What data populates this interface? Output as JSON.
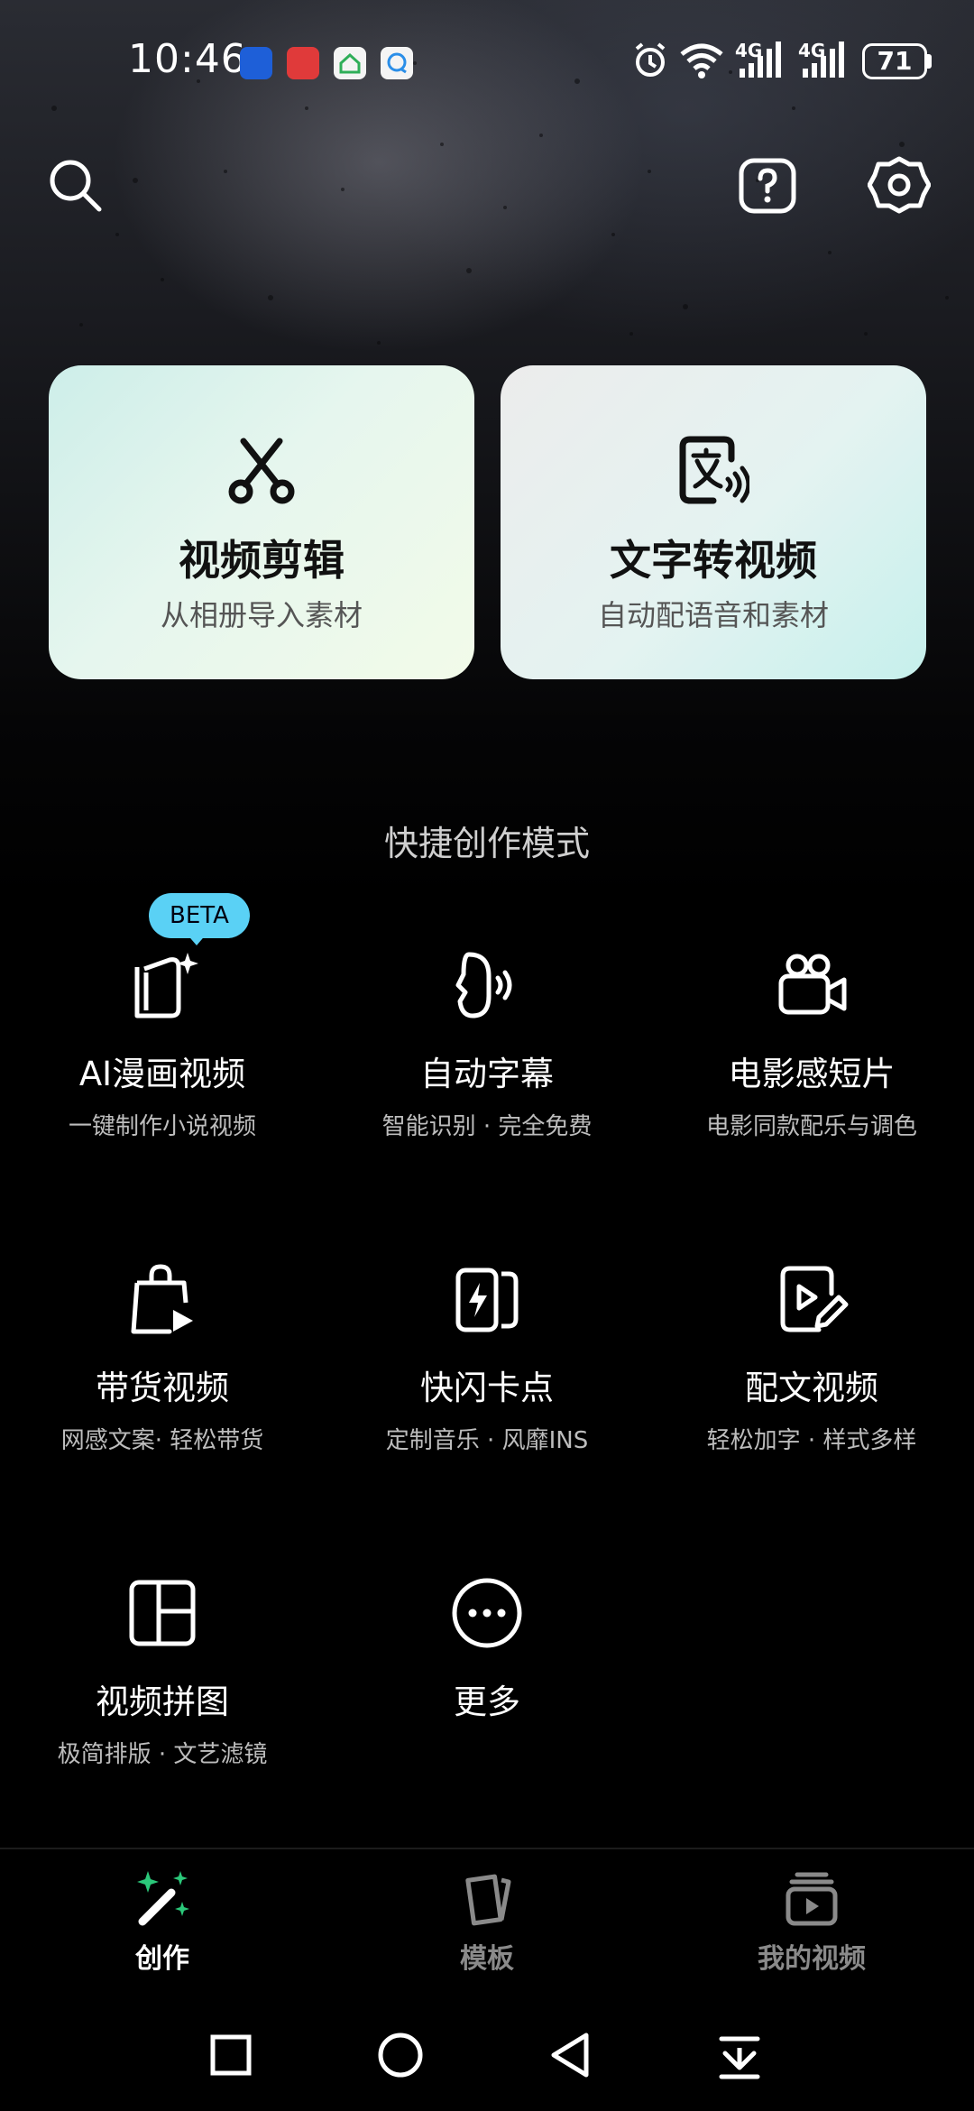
{
  "status_bar": {
    "time": "10:46",
    "battery": "71",
    "network_1": "4G",
    "network_2": "4G",
    "app_icons": [
      "blue-app-icon",
      "red-app-icon",
      "green-house-app-icon",
      "chat-bubble-app-icon"
    ]
  },
  "header": {
    "search_icon": "search-icon",
    "help_icon": "help-icon",
    "settings_icon": "gear-icon"
  },
  "cards": [
    {
      "title": "视频剪辑",
      "subtitle": "从相册导入素材",
      "icon": "scissors-icon"
    },
    {
      "title": "文字转视频",
      "subtitle": "自动配语音和素材",
      "icon": "text-to-speech-icon"
    }
  ],
  "section_title": "快捷创作模式",
  "beta_label": "BETA",
  "modes": [
    {
      "title": "AI漫画视频",
      "subtitle": "一键制作小说视频",
      "icon": "book-sparkle-icon"
    },
    {
      "title": "自动字幕",
      "subtitle": "智能识别 · 完全免费",
      "icon": "speaking-head-icon"
    },
    {
      "title": "电影感短片",
      "subtitle": "电影同款配乐与调色",
      "icon": "video-camera-icon"
    },
    {
      "title": "带货视频",
      "subtitle": "网感文案· 轻松带货",
      "icon": "shopping-bag-play-icon"
    },
    {
      "title": "快闪卡点",
      "subtitle": "定制音乐 · 风靡INS",
      "icon": "flash-cards-icon"
    },
    {
      "title": "配文视频",
      "subtitle": "轻松加字 · 样式多样",
      "icon": "play-edit-icon"
    },
    {
      "title": "视频拼图",
      "subtitle": "极简排版 · 文艺滤镜",
      "icon": "collage-grid-icon"
    },
    {
      "title": "更多",
      "subtitle": "",
      "icon": "more-dots-icon"
    }
  ],
  "tabs": [
    {
      "label": "创作",
      "active": true,
      "icon": "magic-wand-icon"
    },
    {
      "label": "模板",
      "active": false,
      "icon": "template-icon"
    },
    {
      "label": "我的视频",
      "active": false,
      "icon": "my-videos-icon"
    }
  ],
  "colors": {
    "accent_green": "#2bc87a",
    "beta_bg": "#5ad1f5",
    "inactive_tab": "#8a8a8a"
  }
}
